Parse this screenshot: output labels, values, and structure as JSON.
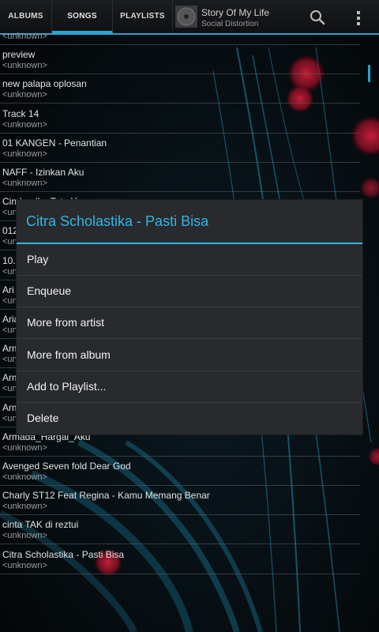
{
  "tabs": [
    {
      "label": "ALBUMS"
    },
    {
      "label": "SONGS"
    },
    {
      "label": "PLAYLISTS"
    }
  ],
  "now_playing": {
    "title": "Story Of My Life",
    "artist": "Social Distortion"
  },
  "songs": [
    {
      "title": "",
      "subtitle": "<unknown>"
    },
    {
      "title": "preview",
      "subtitle": "<unknown>"
    },
    {
      "title": "new palapa oplosan",
      "subtitle": "<unknown>"
    },
    {
      "title": "Track 14",
      "subtitle": "<unknown>"
    },
    {
      "title": "01 KANGEN - Penantian",
      "subtitle": "<unknown>"
    },
    {
      "title": "NAFF - Izinkan Aku",
      "subtitle": "<unknown>"
    },
    {
      "title": "Cinderella_Tata Young",
      "subtitle": "<unknown>"
    },
    {
      "title": "012",
      "subtitle": "<unknown>"
    },
    {
      "title": "10.",
      "subtitle": "<unknown>"
    },
    {
      "title": "Ari",
      "subtitle": "<unknown>"
    },
    {
      "title": "Aria",
      "subtitle": "<unknown>"
    },
    {
      "title": "Arm",
      "subtitle": "<unknown>"
    },
    {
      "title": "Arm",
      "subtitle": "<unknown>"
    },
    {
      "title": "Arm",
      "subtitle": "<unknown>"
    },
    {
      "title": "Armada_Hargai_Aku",
      "subtitle": "<unknown>"
    },
    {
      "title": "Avenged Seven fold Dear God",
      "subtitle": "<unknown>"
    },
    {
      "title": "Charly ST12 Feat Regina - Kamu Memang Benar",
      "subtitle": "<unknown>"
    },
    {
      "title": "cinta TAK di reztui",
      "subtitle": "<unknown>"
    },
    {
      "title": "Citra Scholastika - Pasti Bisa",
      "subtitle": "<unknown>"
    }
  ],
  "context_menu": {
    "title": "Citra Scholastika - Pasti Bisa",
    "items": [
      {
        "label": "Play"
      },
      {
        "label": "Enqueue"
      },
      {
        "label": "More from artist"
      },
      {
        "label": "More from album"
      },
      {
        "label": "Add to Playlist..."
      },
      {
        "label": "Delete"
      }
    ]
  },
  "colors": {
    "accent": "#33b5e5",
    "dialog_bg": "#282a2d",
    "background": "#050608"
  }
}
